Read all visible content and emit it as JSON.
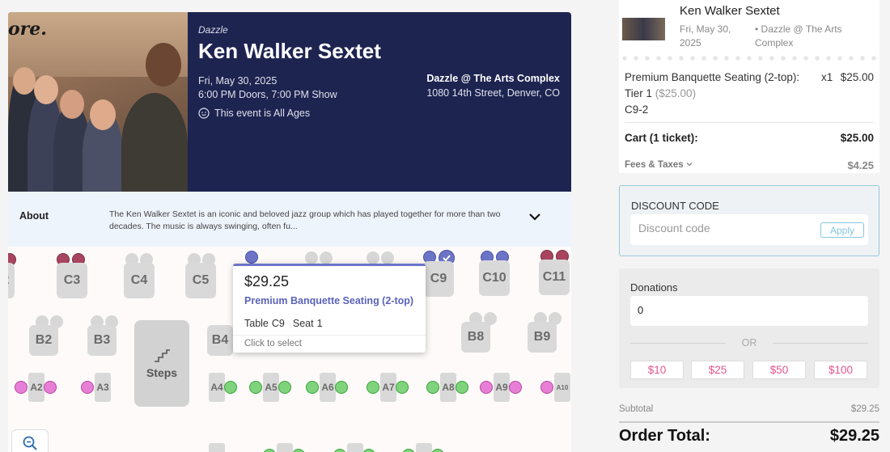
{
  "hero": {
    "photo_script": "ore.",
    "venue_label": "Dazzle",
    "title": "Ken Walker Sextet",
    "date": "Fri, May 30, 2025",
    "times": "6:00 PM Doors, 7:00 PM Show",
    "ages": "This event is All Ages",
    "venue_name": "Dazzle @ The Arts Complex",
    "venue_address": "1080 14th Street, Denver, CO"
  },
  "about": {
    "label": "About",
    "text": "The Ken Walker Sextet is an iconic and beloved jazz group which has played together for more than two decades. The music is always swinging, often fu..."
  },
  "seatmap": {
    "tables_row1": [
      "2",
      "C3",
      "C4",
      "C5",
      "C9",
      "C10",
      "C11"
    ],
    "tables_row2": [
      "B2",
      "B3",
      "B4",
      "B8",
      "B9"
    ],
    "tables_row3": [
      "A2",
      "A3",
      "A4",
      "A5",
      "A6",
      "A7",
      "A8",
      "A9",
      "A10"
    ],
    "steps_label": "Steps",
    "tooltip": {
      "price": "$29.25",
      "seat_type": "Premium Banquette Seating (2-top)",
      "table_label": "Table",
      "table_value": "C9",
      "seat_label": "Seat",
      "seat_value": "1",
      "hint": "Click to select"
    }
  },
  "cart": {
    "title": "Ken Walker Sextet",
    "date": "Fri, May 30, 2025",
    "venue": "Dazzle @ The Arts Complex",
    "item_name": "Premium Banquette Seating (2-top):",
    "item_qty": "x1",
    "item_price": "$25.00",
    "item_tier": "Tier 1",
    "item_tier_price": "($25.00)",
    "item_seat": "C9-2",
    "total_label": "Cart (1 ticket):",
    "total_value": "$25.00",
    "fees_label": "Fees & Taxes",
    "fees_value": "$4.25"
  },
  "discount": {
    "label": "DISCOUNT CODE",
    "placeholder": "Discount code",
    "apply_label": "Apply"
  },
  "donations": {
    "label": "Donations",
    "value": "0",
    "or_text": "OR",
    "amounts": [
      "$10",
      "$25",
      "$50",
      "$100"
    ]
  },
  "summary": {
    "subtotal_label": "Subtotal",
    "subtotal_value": "$29.25",
    "order_total_label": "Order Total:",
    "order_total_value": "$29.25"
  },
  "colors": {
    "hero_bg": "#1d2450",
    "accent_blue": "#6c74c7",
    "donation_pink": "#e5548f",
    "seat_maroon": "#a8445e",
    "seat_green": "#7ed37c",
    "seat_pink": "#e77fd6"
  }
}
